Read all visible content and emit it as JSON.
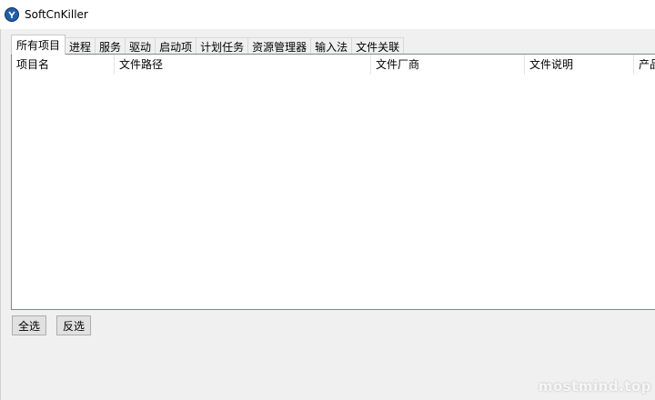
{
  "window": {
    "title": "SoftCnKiller"
  },
  "tabs": [
    {
      "label": "所有项目",
      "active": true
    },
    {
      "label": "进程",
      "active": false
    },
    {
      "label": "服务",
      "active": false
    },
    {
      "label": "驱动",
      "active": false
    },
    {
      "label": "启动项",
      "active": false
    },
    {
      "label": "计划任务",
      "active": false
    },
    {
      "label": "资源管理器",
      "active": false
    },
    {
      "label": "输入法",
      "active": false
    },
    {
      "label": "文件关联",
      "active": false
    }
  ],
  "list": {
    "columns": [
      {
        "label": "项目名"
      },
      {
        "label": "文件路径"
      },
      {
        "label": "文件厂商"
      },
      {
        "label": "文件说明"
      },
      {
        "label": "产品"
      }
    ],
    "rows": []
  },
  "buttons": {
    "select_all": "全选",
    "invert_select": "反选"
  },
  "watermark": "mostmind.top",
  "colors": {
    "window_bg": "#f0f0f0",
    "panel_bg": "#ffffff",
    "icon_blue": "#1f5fa8"
  }
}
